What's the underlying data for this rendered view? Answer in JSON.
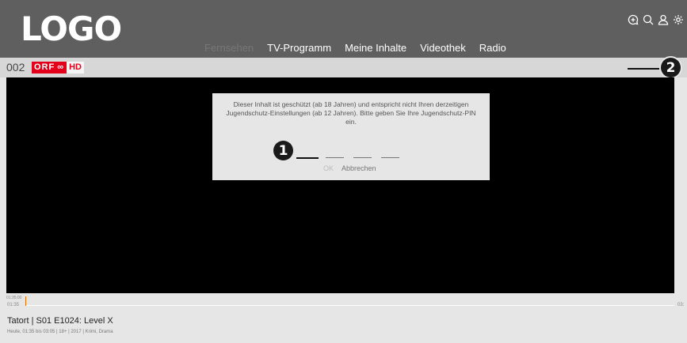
{
  "header": {
    "logo": "LOGO",
    "nav": [
      {
        "label": "Fernsehen",
        "active": true
      },
      {
        "label": "TV-Programm",
        "active": false
      },
      {
        "label": "Meine Inhalte",
        "active": false
      },
      {
        "label": "Videothek",
        "active": false
      },
      {
        "label": "Radio",
        "active": false
      }
    ],
    "icons": [
      "chat-add-icon",
      "search-icon",
      "user-icon",
      "settings-icon"
    ]
  },
  "channel": {
    "number": "002",
    "logo_text": "ORF",
    "logo_suffix": "∞",
    "logo_hd": "HD"
  },
  "markers": {
    "one": "1",
    "two": "2"
  },
  "dialog": {
    "message": "Dieser Inhalt ist geschützt (ab 18 Jahren) und entspricht nicht Ihren derzeitigen Jugendschutz-Einstellungen (ab 12 Jahren). Bitte geben Sie Ihre Jugendschutz-PIN ein.",
    "ok_label": "OK",
    "cancel_label": "Abbrechen",
    "pin_length": 4
  },
  "timeline": {
    "current_time": "01:35:00",
    "start_time": "01:35",
    "end_time": "03:",
    "progress": 0.0
  },
  "program": {
    "title": "Tatort | S01 E1024: Level X",
    "meta": "Heute, 01:35 bis 03:05 | 18+ | 2017 | Krimi, Drama"
  },
  "colors": {
    "header_bg": "#5f5f5f",
    "accent_orange": "#e07000",
    "orf_red": "#e2001a"
  }
}
